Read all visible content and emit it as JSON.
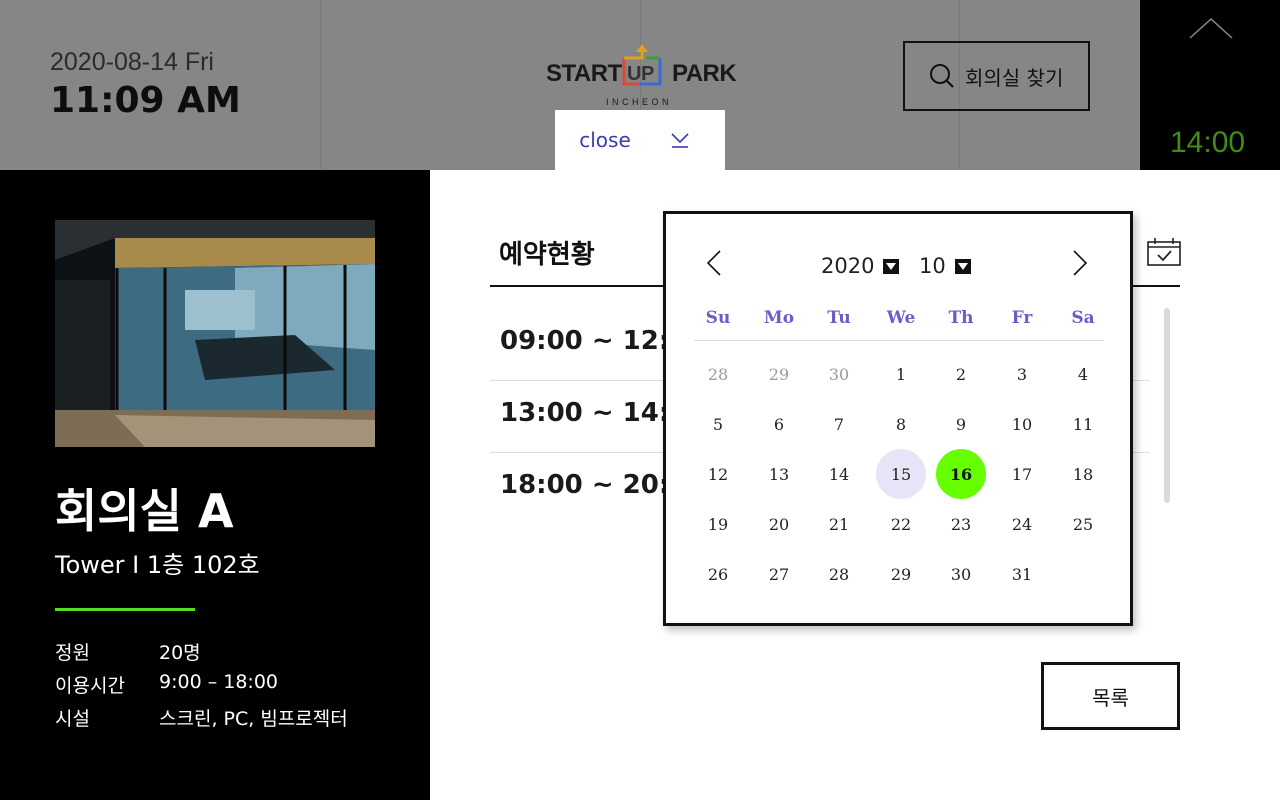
{
  "header": {
    "date": "2020-08-14 Fri",
    "time": "11:09 AM",
    "logo": {
      "left": "START",
      "mid": "UP",
      "right": "PARK",
      "sub": "INCHEON"
    },
    "find_label": "회의실 찾기",
    "close_label": "close",
    "panel_time": "14:00"
  },
  "room": {
    "name": "회의실 A",
    "location": "Tower I  1층 102호",
    "info": [
      {
        "key": "정원",
        "value": "20명"
      },
      {
        "key": "이용시간",
        "value": "9:00 – 18:00"
      },
      {
        "key": "시설",
        "value": "스크린, PC, 빔프로젝터"
      }
    ]
  },
  "reservations": {
    "title": "예약현황",
    "slots": [
      "09:00 ~ 12:",
      "13:00 ~ 14:",
      "18:00 ~ 20:"
    ],
    "list_button": "목록"
  },
  "calendar": {
    "year": "2020",
    "month": "10",
    "weekdays": [
      "Su",
      "Mo",
      "Tu",
      "We",
      "Th",
      "Fr",
      "Sa"
    ],
    "weeks": [
      [
        "28",
        "29",
        "30",
        "1",
        "2",
        "3",
        "4"
      ],
      [
        "5",
        "6",
        "7",
        "8",
        "9",
        "10",
        "11"
      ],
      [
        "12",
        "13",
        "14",
        "15",
        "16",
        "17",
        "18"
      ],
      [
        "19",
        "20",
        "21",
        "22",
        "23",
        "24",
        "25"
      ],
      [
        "26",
        "27",
        "28",
        "29",
        "30",
        "31"
      ]
    ],
    "muted_days": [
      [
        0,
        0
      ],
      [
        0,
        1
      ],
      [
        0,
        2
      ]
    ],
    "highlighted_day": [
      2,
      3
    ],
    "selected_day": [
      2,
      4
    ],
    "accent_color": "#66ff00",
    "highlight_color": "#e8e4f8",
    "weekday_color": "#6e5bc6"
  }
}
